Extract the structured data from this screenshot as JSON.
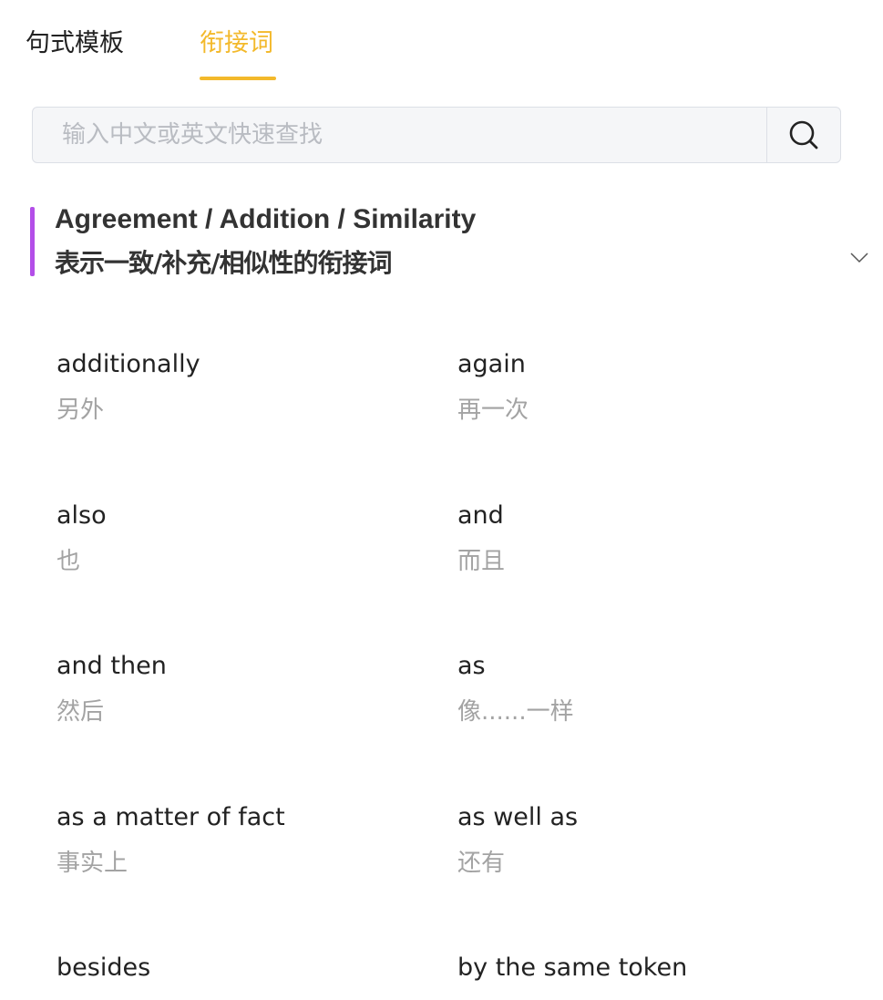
{
  "tabs": [
    {
      "label": "句式模板"
    },
    {
      "label": "衔接词"
    }
  ],
  "search": {
    "placeholder": "输入中文或英文快速查找",
    "icon": "search-icon"
  },
  "colors": {
    "accent": "#f3b92b",
    "section_bar": "#b34ee8",
    "translation": "#a3a3a3"
  },
  "section": {
    "title_en": "Agreement / Addition / Similarity",
    "title_zh": "表示一致/补充/相似性的衔接词",
    "toggle_icon": "chevron-down-icon"
  },
  "words": [
    {
      "en": "additionally",
      "zh": "另外"
    },
    {
      "en": "again",
      "zh": "再一次"
    },
    {
      "en": "also",
      "zh": "也"
    },
    {
      "en": "and",
      "zh": "而且"
    },
    {
      "en": "and then",
      "zh": "然后"
    },
    {
      "en": "as",
      "zh": "像......一样"
    },
    {
      "en": "as a matter of fact",
      "zh": "事实上"
    },
    {
      "en": "as well as",
      "zh": "还有"
    },
    {
      "en": "besides",
      "zh": ""
    },
    {
      "en": "by the same token",
      "zh": ""
    }
  ]
}
